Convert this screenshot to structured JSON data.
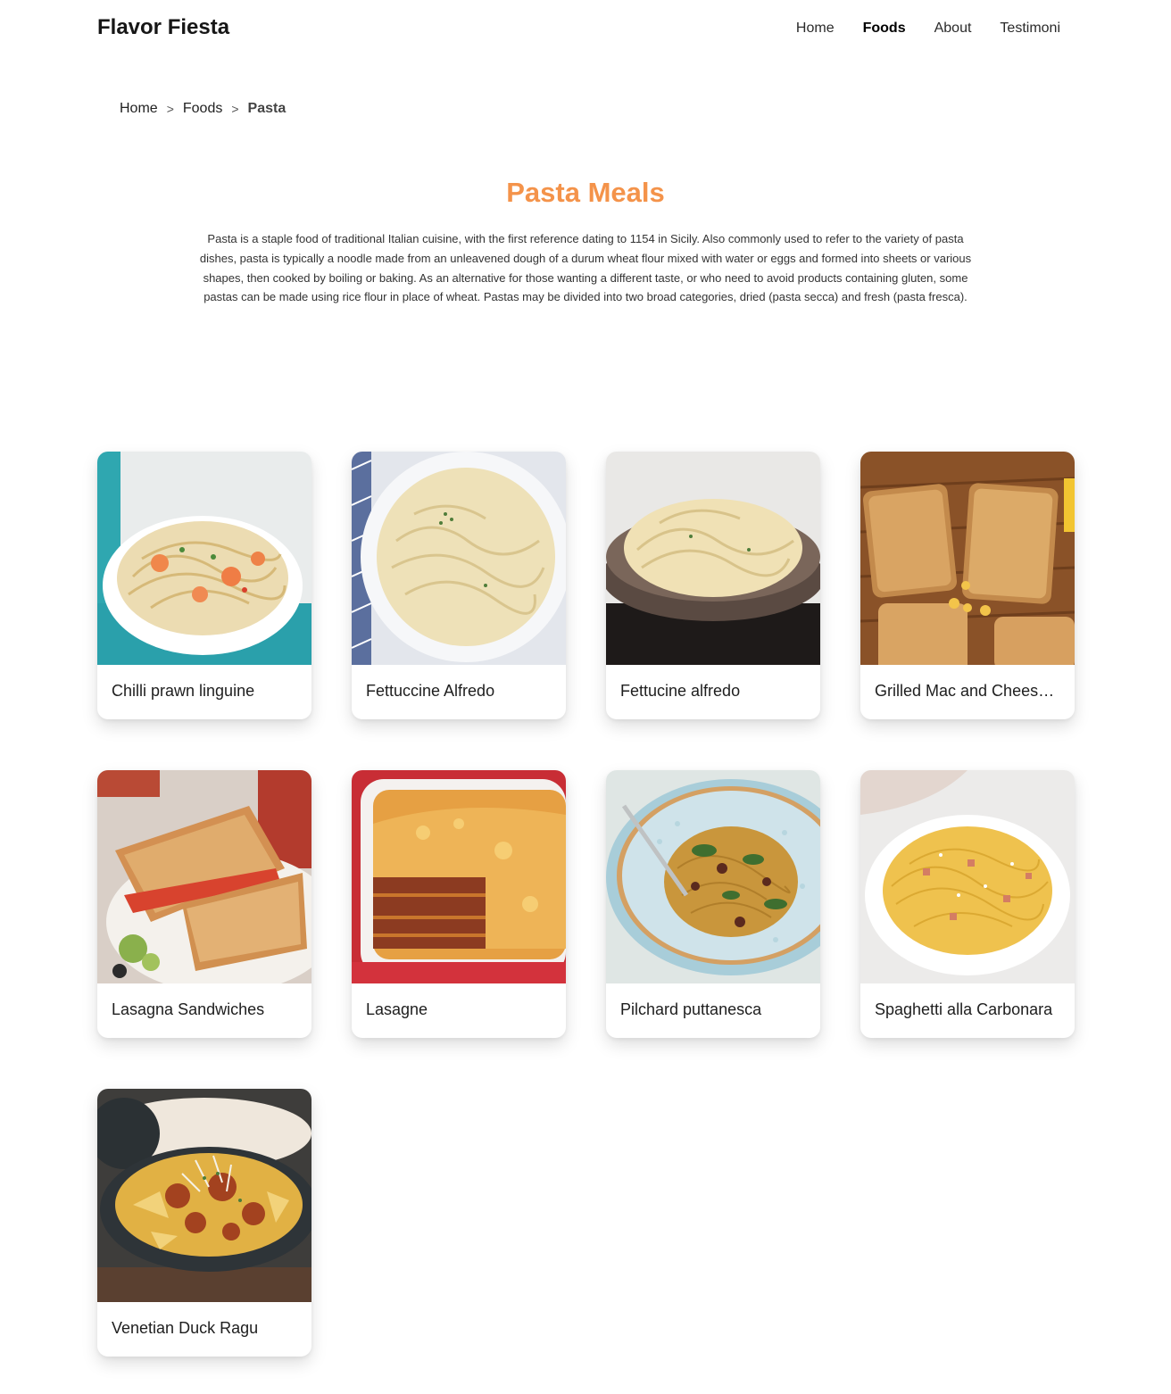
{
  "brand": "Flavor Fiesta",
  "nav": {
    "home": "Home",
    "foods": "Foods",
    "about": "About",
    "testimoni": "Testimoni"
  },
  "breadcrumb": {
    "home": "Home",
    "sep1": ">",
    "foods": "Foods",
    "sep2": ">",
    "current": "Pasta"
  },
  "page": {
    "title": "Pasta Meals",
    "description": "Pasta is a staple food of traditional Italian cuisine, with the first reference dating to 1154 in Sicily. Also commonly used to refer to the variety of pasta dishes, pasta is typically a noodle made from an unleavened dough of a durum wheat flour mixed with water or eggs and formed into sheets or various shapes, then cooked by boiling or baking. As an alternative for those wanting a different taste, or who need to avoid products containing gluten, some pastas can be made using rice flour in place of wheat. Pastas may be divided into two broad categories, dried (pasta secca) and fresh (pasta fresca)."
  },
  "accent_color": "#f4934a",
  "meals": [
    {
      "name": "Chilli prawn linguine"
    },
    {
      "name": "Fettuccine Alfredo"
    },
    {
      "name": "Fettucine alfredo"
    },
    {
      "name": "Grilled Mac and Cheese Sandwich"
    },
    {
      "name": "Lasagna Sandwiches"
    },
    {
      "name": "Lasagne"
    },
    {
      "name": "Pilchard puttanesca"
    },
    {
      "name": "Spaghetti alla Carbonara"
    },
    {
      "name": "Venetian Duck Ragu"
    }
  ]
}
